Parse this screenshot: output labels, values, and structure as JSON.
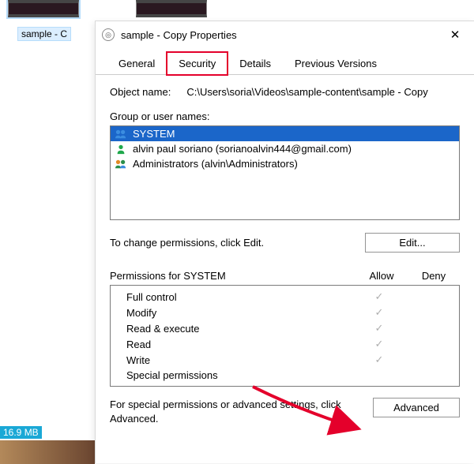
{
  "thumbs": {
    "left_label": "sample - C",
    "size_overlay": "16.9 MB"
  },
  "dialog": {
    "title": "sample - Copy Properties",
    "close_glyph": "✕",
    "tabs": {
      "general": "General",
      "security": "Security",
      "details": "Details",
      "previous": "Previous Versions"
    },
    "object_name_label": "Object name:",
    "object_name_value": "C:\\Users\\soria\\Videos\\sample-content\\sample - Copy",
    "group_label": "Group or user names:",
    "principals": [
      {
        "label": "SYSTEM"
      },
      {
        "label": "alvin paul soriano (sorianoalvin444@gmail.com)"
      },
      {
        "label": "Administrators (alvin\\Administrators)"
      }
    ],
    "edit_hint": "To change permissions, click Edit.",
    "edit_button": "Edit...",
    "perm_for_label": "Permissions for SYSTEM",
    "perm_cols": {
      "allow": "Allow",
      "deny": "Deny"
    },
    "perms": [
      {
        "label": "Full control",
        "allow": true
      },
      {
        "label": "Modify",
        "allow": true
      },
      {
        "label": "Read & execute",
        "allow": true
      },
      {
        "label": "Read",
        "allow": true
      },
      {
        "label": "Write",
        "allow": true
      },
      {
        "label": "Special permissions",
        "allow": false
      }
    ],
    "advanced_hint": "For special permissions or advanced settings, click Advanced.",
    "advanced_button": "Advanced"
  }
}
